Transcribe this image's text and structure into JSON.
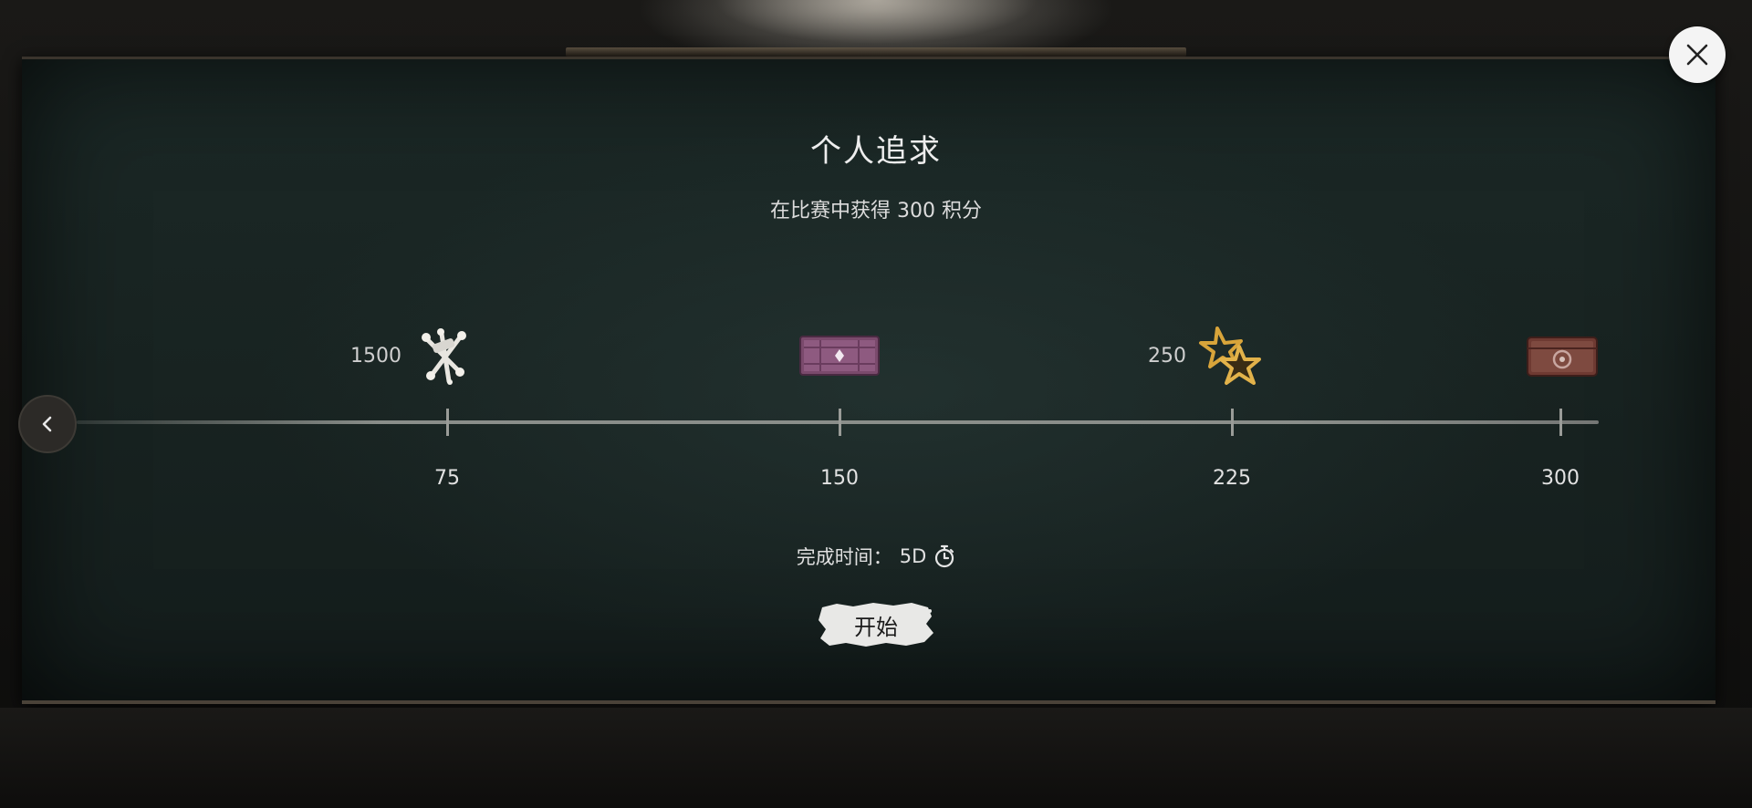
{
  "quest": {
    "title": "个人追求",
    "description": "在比赛中获得 300 积分"
  },
  "milestones": [
    {
      "points": "75",
      "reward_icon": "bone-bundle-icon",
      "reward_quantity": "1500"
    },
    {
      "points": "150",
      "reward_icon": "purple-crate-icon",
      "reward_quantity": ""
    },
    {
      "points": "225",
      "reward_icon": "gold-star-burst-icon",
      "reward_quantity": "250"
    },
    {
      "points": "300",
      "reward_icon": "leather-chest-icon",
      "reward_quantity": ""
    }
  ],
  "completion": {
    "label": "完成时间：",
    "value": "5D",
    "icon": "stopwatch-icon"
  },
  "actions": {
    "start_label": "开始",
    "close_icon": "close-icon",
    "back_icon": "chevron-left-icon"
  },
  "colors": {
    "board": "#182321",
    "start_button": "#e8e8e6",
    "close_button": "#f4f4f4"
  }
}
